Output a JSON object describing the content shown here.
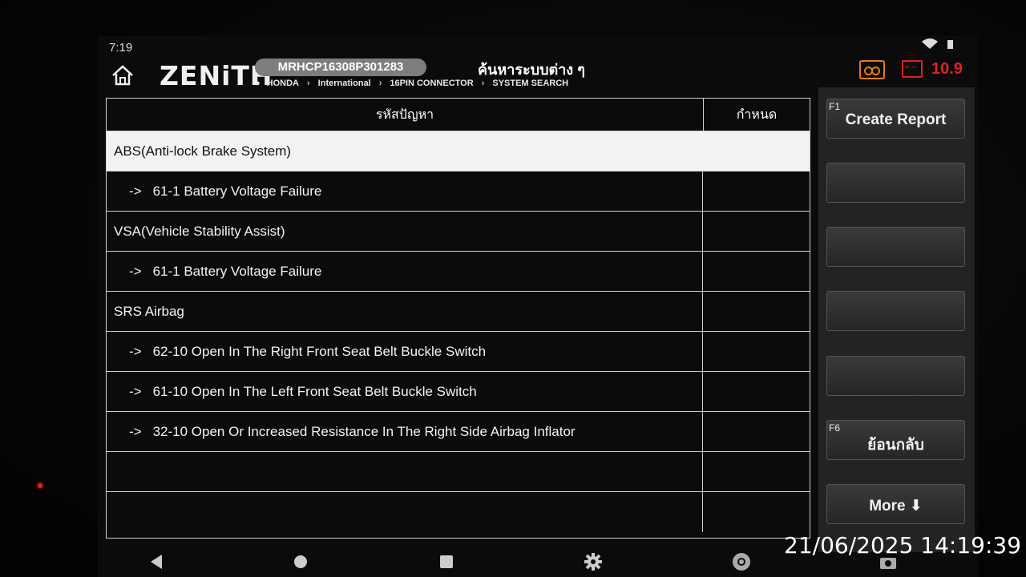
{
  "status_bar": {
    "time": "7:19"
  },
  "header": {
    "logo": "ZENiTH",
    "vin": "MRHCP16308P301283",
    "page_title": "ค้นหาระบบต่าง ๆ",
    "breadcrumb": [
      "HONDA",
      "International",
      "16PIN CONNECTOR",
      "SYSTEM SEARCH"
    ],
    "voltage": "10.9",
    "colors": {
      "record": "#e47c1e",
      "battery": "#e02020"
    }
  },
  "table": {
    "headers": {
      "code": "รหัสปัญหา",
      "definition": "กำหนด"
    },
    "rows": [
      {
        "kind": "system",
        "text": "ABS(Anti-lock Brake System)",
        "selected": true
      },
      {
        "kind": "fault",
        "arrow": "->",
        "text": "61-1 Battery Voltage Failure"
      },
      {
        "kind": "system",
        "text": "VSA(Vehicle Stability Assist)"
      },
      {
        "kind": "fault",
        "arrow": "->",
        "text": "61-1 Battery Voltage Failure"
      },
      {
        "kind": "system",
        "text": "SRS Airbag"
      },
      {
        "kind": "fault",
        "arrow": "->",
        "text": "62-10 Open In The Right Front Seat Belt Buckle Switch"
      },
      {
        "kind": "fault",
        "arrow": "->",
        "text": "61-10 Open In The Left Front Seat Belt Buckle Switch"
      },
      {
        "kind": "fault",
        "arrow": "->",
        "text": "32-10 Open Or Increased Resistance In The Right Side Airbag Inflator"
      },
      {
        "kind": "empty",
        "text": ""
      },
      {
        "kind": "empty",
        "text": ""
      }
    ]
  },
  "function_buttons": [
    {
      "key": "F1",
      "label": "Create Report"
    },
    {
      "key": "",
      "label": ""
    },
    {
      "key": "",
      "label": ""
    },
    {
      "key": "",
      "label": ""
    },
    {
      "key": "",
      "label": ""
    },
    {
      "key": "F6",
      "label": "ย้อนกลับ"
    },
    {
      "key": "",
      "label": "More ⬇"
    }
  ],
  "nav_bar": [
    "back-icon",
    "home-circle-icon",
    "recents-square-icon",
    "settings-gear-icon",
    "chrome-icon",
    "camera-icon"
  ],
  "timestamp": "21/06/2025 14:19:39"
}
